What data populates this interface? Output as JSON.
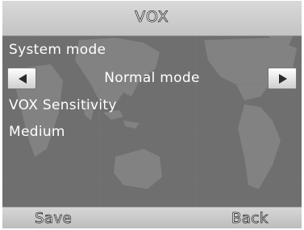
{
  "header": {
    "title": "VOX"
  },
  "system_mode": {
    "label": "System mode",
    "value": "Normal mode",
    "prev_icon": "left-triangle-icon",
    "next_icon": "right-triangle-icon"
  },
  "vox_sensitivity": {
    "label": "VOX Sensitivity",
    "value": "Medium"
  },
  "softkeys": {
    "left": "Save",
    "right": "Back"
  },
  "colors": {
    "background": "#6f6f6f",
    "map": "#858585",
    "bars": "#d0d0d0",
    "text": "#ffffff"
  }
}
